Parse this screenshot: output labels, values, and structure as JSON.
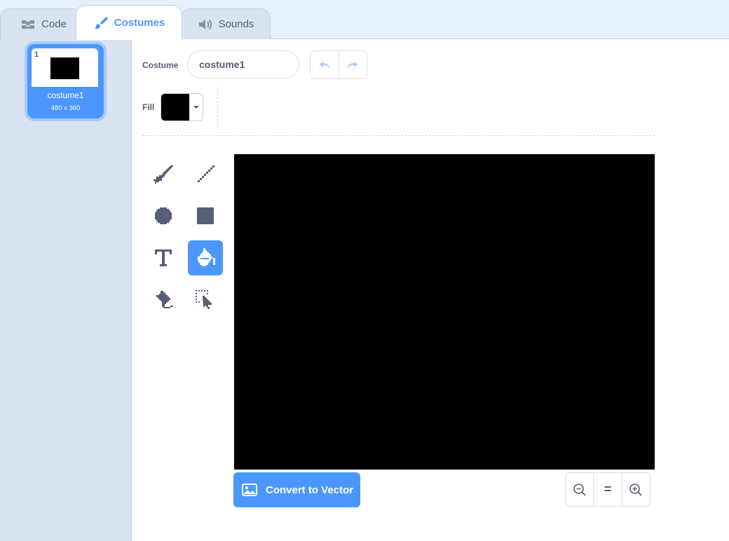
{
  "tabs": {
    "code": "Code",
    "costumes": "Costumes",
    "sounds": "Sounds"
  },
  "costume_list": {
    "items": [
      {
        "index": "1",
        "name": "costume1",
        "size": "480 x 360",
        "selected": true
      }
    ]
  },
  "editor": {
    "costume_label": "Costume",
    "costume_name": "costume1",
    "fill_label": "Fill",
    "fill_color": "#000000",
    "canvas_color": "#000000",
    "active_tool": "fill",
    "convert_label": "Convert to Vector",
    "zoom_reset_label": "="
  },
  "colors": {
    "accent": "#4c97ff",
    "tab_bar": "#e5f0ff",
    "sidebar": "#d9e3f2",
    "text": "#575e75"
  }
}
